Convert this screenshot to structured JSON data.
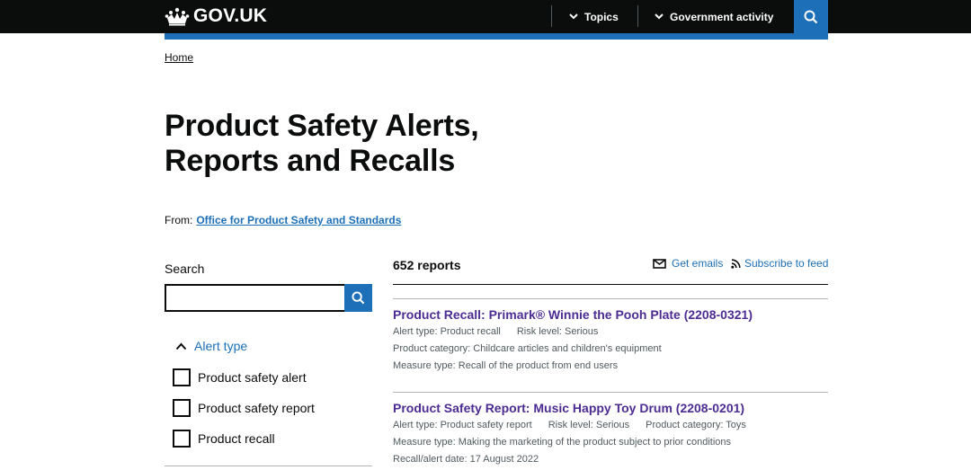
{
  "header": {
    "logo_text": "GOV.UK",
    "nav": [
      {
        "label": "Topics"
      },
      {
        "label": "Government activity"
      }
    ],
    "search_icon": "search-icon"
  },
  "colors": {
    "header_bg": "#0b0c0c",
    "accent": "#1d70b8",
    "visited_link": "#4c2c92",
    "secondary_text": "#505a5f"
  },
  "breadcrumb": {
    "home": "Home"
  },
  "page": {
    "title_line1": "Product Safety Alerts,",
    "title_line2": "Reports and Recalls",
    "from_label": "From:",
    "from_org": "Office for Product Safety and Standards"
  },
  "search": {
    "label": "Search",
    "value": "",
    "placeholder": ""
  },
  "filter": {
    "heading": "Alert type",
    "options": [
      {
        "label": "Product safety alert",
        "checked": false
      },
      {
        "label": "Product safety report",
        "checked": false
      },
      {
        "label": "Product recall",
        "checked": false
      }
    ]
  },
  "results": {
    "count": "652 reports",
    "get_emails": "Get emails",
    "subscribe": "Subscribe to feed",
    "items": [
      {
        "title": "Product Recall: Primark® Winnie the Pooh Plate (2208-0321)",
        "alert_type": "Alert type: Product recall",
        "risk_level": "Risk level: Serious",
        "product_category": "Product category: Childcare articles and children's equipment",
        "measure_type": "Measure type: Recall of the product from end users"
      },
      {
        "title": "Product Safety Report: Music Happy Toy Drum (2208-0201)",
        "alert_type": "Alert type: Product safety report",
        "risk_level": "Risk level: Serious",
        "product_category": "Product category: Toys",
        "measure_type": "Measure type: Making the marketing of the product subject to prior conditions",
        "date": "Recall/alert date: 17 August 2022"
      }
    ]
  }
}
